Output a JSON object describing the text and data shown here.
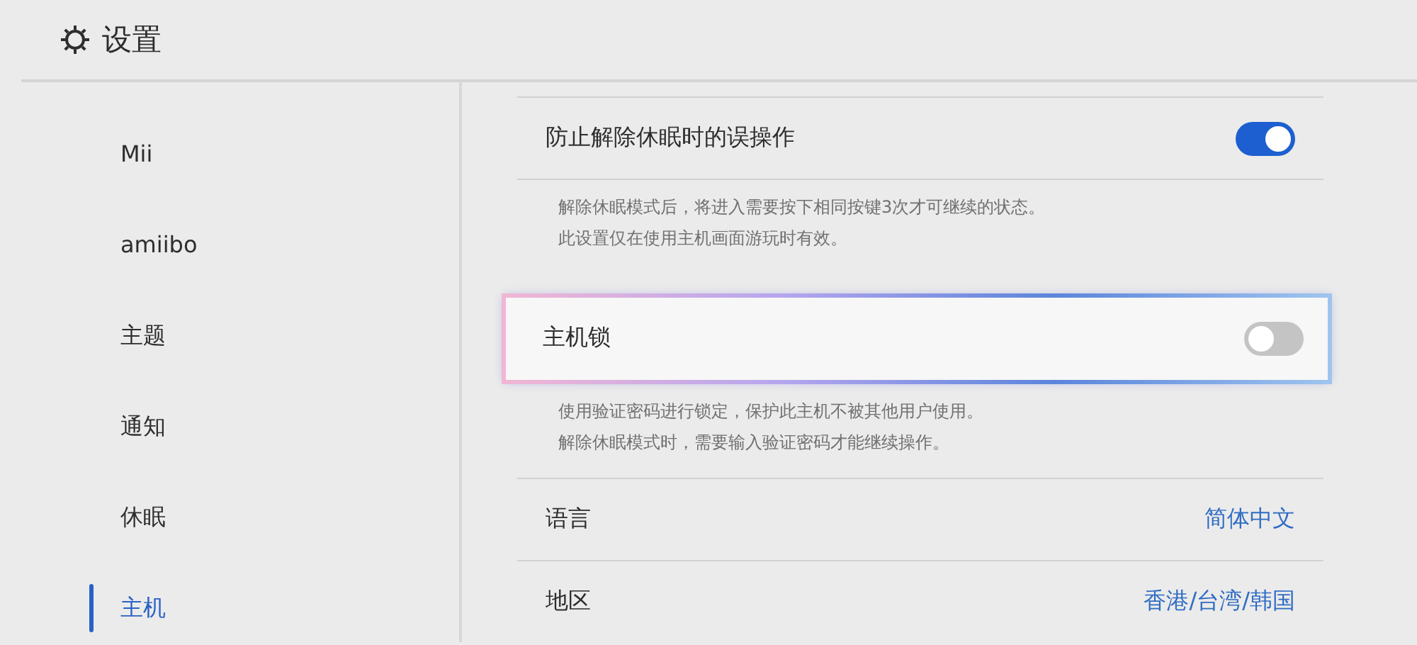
{
  "header": {
    "title": "设置"
  },
  "sidebar": {
    "items": [
      {
        "label": "Mii",
        "selected": false
      },
      {
        "label": "amiibo",
        "selected": false
      },
      {
        "label": "主题",
        "selected": false
      },
      {
        "label": "通知",
        "selected": false
      },
      {
        "label": "休眠",
        "selected": false
      },
      {
        "label": "主机",
        "selected": true
      }
    ]
  },
  "settings": [
    {
      "kind": "toggle",
      "label": "防止解除休眠时的误操作",
      "on": true,
      "selected": false,
      "description": [
        "解除休眠模式后，将进入需要按下相同按键3次才可继续的状态。",
        "此设置仅在使用主机画面游玩时有效。"
      ]
    },
    {
      "kind": "toggle",
      "label": "主机锁",
      "on": false,
      "selected": true,
      "description": [
        "使用验证密码进行锁定，保护此主机不被其他用户使用。",
        "解除休眠模式时，需要输入验证密码才能继续操作。"
      ]
    },
    {
      "kind": "value",
      "label": "语言",
      "value": "简体中文",
      "selected": false
    },
    {
      "kind": "value",
      "label": "地区",
      "value": "香港/台湾/韩国",
      "selected": false
    }
  ]
}
